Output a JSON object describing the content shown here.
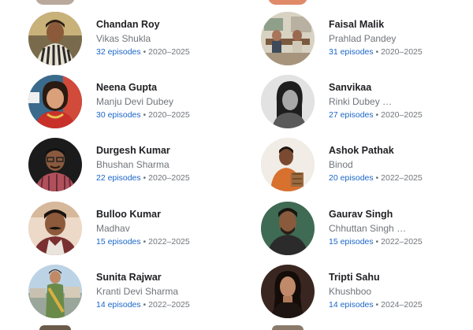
{
  "cast": [
    {
      "name": "Chandan Roy",
      "role": "Vikas Shukla",
      "episodes": "32 episodes",
      "sep": " • ",
      "years": "2020–2025",
      "avatar": "portrait-man-striped-shirt"
    },
    {
      "name": "Faisal Malik",
      "role": "Prahlad Pandey",
      "episodes": "31 episodes",
      "sep": " • ",
      "years": "2020–2025",
      "avatar": "portrait-office-scene"
    },
    {
      "name": "Neena Gupta",
      "role": "Manju Devi Dubey",
      "episodes": "30 episodes",
      "sep": " • ",
      "years": "2020–2025",
      "avatar": "portrait-woman-red-saree"
    },
    {
      "name": "Sanvikaa",
      "role": "Rinki Dubey  …",
      "episodes": "27 episodes",
      "sep": " • ",
      "years": "2020–2025",
      "avatar": "portrait-woman-bw"
    },
    {
      "name": "Durgesh Kumar",
      "role": "Bhushan Sharma",
      "episodes": "22 episodes",
      "sep": " • ",
      "years": "2020–2025",
      "avatar": "portrait-man-glasses"
    },
    {
      "name": "Ashok Pathak",
      "role": "Binod",
      "episodes": "20 episodes",
      "sep": " • ",
      "years": "2022–2025",
      "avatar": "portrait-man-orange-shirt"
    },
    {
      "name": "Bulloo Kumar",
      "role": "Madhav",
      "episodes": "15 episodes",
      "sep": " • ",
      "years": "2022–2025",
      "avatar": "portrait-man-mustache"
    },
    {
      "name": "Gaurav Singh",
      "role": "Chhuttan Singh  …",
      "episodes": "15 episodes",
      "sep": " • ",
      "years": "2022–2025",
      "avatar": "portrait-man-green-bg"
    },
    {
      "name": "Sunita Rajwar",
      "role": "Kranti Devi Sharma",
      "episodes": "14 episodes",
      "sep": " • ",
      "years": "2022–2025",
      "avatar": "portrait-woman-saree-outdoor"
    },
    {
      "name": "Tripti Sahu",
      "role": "Khushboo",
      "episodes": "14 episodes",
      "sep": " • ",
      "years": "2024–2025",
      "avatar": "portrait-woman-dark-bg"
    }
  ]
}
